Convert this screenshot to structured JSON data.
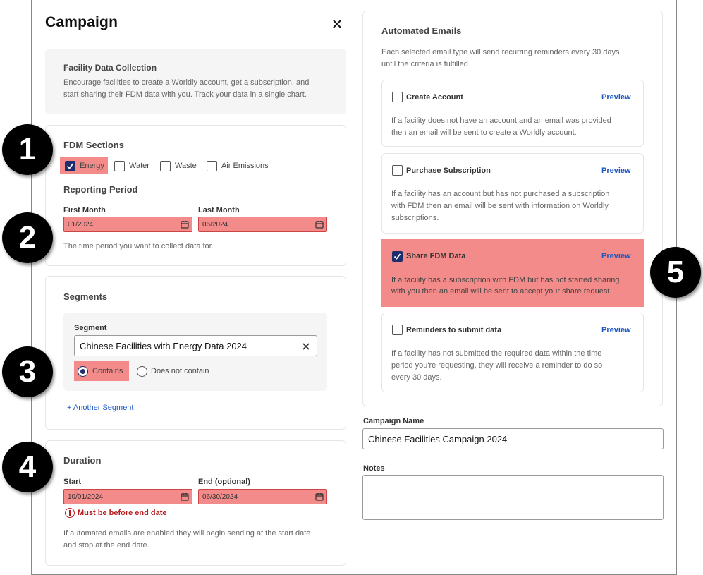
{
  "dialog": {
    "title": "Campaign"
  },
  "facility": {
    "heading": "Facility Data Collection",
    "description": [
      "Encourage facilities to create a Worldly account, get a subscription, and",
      "start sharing their FDM data with you. Track your data in a single chart."
    ]
  },
  "fdm": {
    "heading": "FDM Sections",
    "options": [
      {
        "label": "Energy",
        "checked": true
      },
      {
        "label": "Water",
        "checked": false
      },
      {
        "label": "Waste",
        "checked": false
      },
      {
        "label": "Air Emissions",
        "checked": false
      }
    ]
  },
  "reporting": {
    "heading": "Reporting Period",
    "first_label": "First Month",
    "first_value": "01/2024",
    "last_label": "Last Month",
    "last_value": "06/2024",
    "hint": "The time period you want to collect data for."
  },
  "segments": {
    "heading": "Segments",
    "segment_label": "Segment",
    "segment_value": "Chinese Facilities with Energy Data 2024",
    "contains_label": "Contains",
    "not_contains_label": "Does not contain",
    "selected": "contains",
    "add_link": "+ Another Segment"
  },
  "duration": {
    "heading": "Duration",
    "start_label": "Start",
    "start_value": "10/01/2024",
    "end_label": "End (optional)",
    "end_value": "06/30/2024",
    "error": "Must be before end date",
    "hint": [
      "If automated emails are enabled they will begin sending at the start date",
      "and stop at the end date."
    ]
  },
  "emails": {
    "heading": "Automated Emails",
    "intro": [
      "Each selected email type will send recurring reminders every 30 days",
      "until the criteria is fulfilled"
    ],
    "preview_label": "Preview",
    "items": [
      {
        "title": "Create Account",
        "checked": false,
        "desc": [
          "If a facility does not have an account and an email was provided",
          "then an email will be sent to create a Worldly account."
        ]
      },
      {
        "title": "Purchase Subscription",
        "checked": false,
        "desc": [
          "If a facility has an account but has not purchased a subscription",
          "with FDM then an email will be sent with information on Worldly",
          "subscriptions."
        ]
      },
      {
        "title": "Share FDM Data",
        "checked": true,
        "desc": [
          "If a facility has a subscription with FDM but has not started sharing",
          "with you then an email will be sent to accept your share request."
        ]
      },
      {
        "title": "Reminders to submit data",
        "checked": false,
        "desc": [
          "If a facility has not submitted the required data within the time",
          "period you're requesting, they will receive a reminder to do so",
          "every 30 days."
        ]
      }
    ]
  },
  "campaign": {
    "name_label": "Campaign Name",
    "name_value": "Chinese Facilities Campaign 2024"
  },
  "notes": {
    "label": "Notes",
    "value": ""
  },
  "badges": [
    "1",
    "2",
    "3",
    "4",
    "5"
  ],
  "colors": {
    "highlight": "#f28b89",
    "accent": "#1e2d6e",
    "link": "#1b56c4",
    "error": "#b81d1d"
  }
}
